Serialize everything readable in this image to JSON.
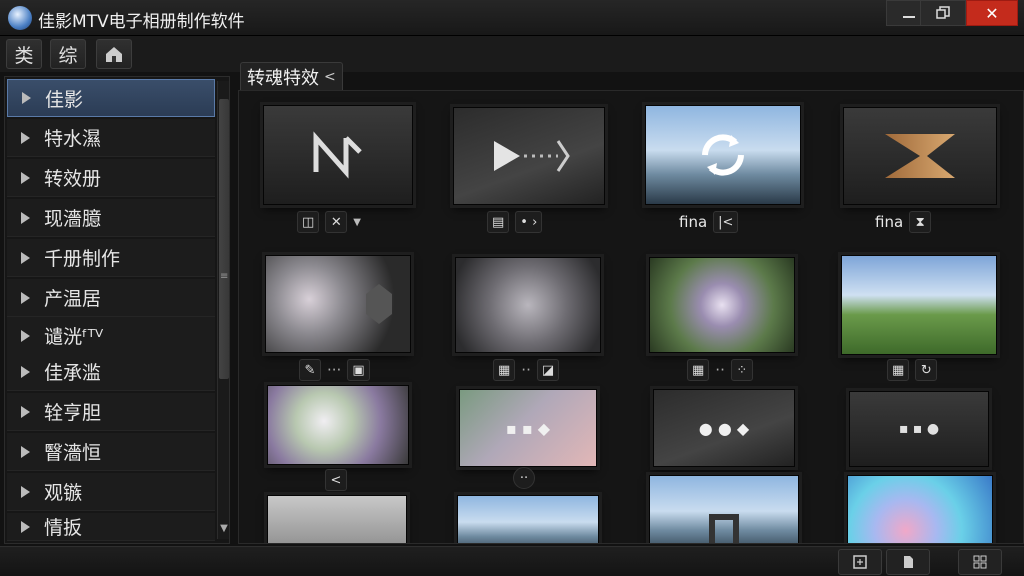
{
  "window": {
    "title": "佳影MTV电子相册制作软件",
    "minimize_icon": "minimize-icon",
    "maximize_icon": "restore-icon",
    "close_label": "✕"
  },
  "toolbar": {
    "button1_label": "类",
    "button2_label": "综",
    "button3_icon": "home-lock-icon"
  },
  "sidebar": {
    "items": [
      {
        "label": "佳影",
        "active": true
      },
      {
        "label": "特水濕"
      },
      {
        "label": "转效册"
      },
      {
        "label": "现濇臆"
      },
      {
        "label": "千册制作"
      },
      {
        "label": "产温居"
      },
      {
        "label": "谴洸ᶠᵀⱽ"
      },
      {
        "label": "佳承滥"
      },
      {
        "label": "辁亨胆"
      },
      {
        "label": "瞖濇恒"
      },
      {
        "label": "观镞"
      },
      {
        "label": "情扳"
      }
    ]
  },
  "tab": {
    "label": "转魂特效",
    "chevron": "<"
  },
  "thumbnails": [
    {
      "caption_text": "",
      "style": "dark1"
    },
    {
      "caption_text": "",
      "style": "dark2"
    },
    {
      "caption_text": "fina",
      "style": "sky"
    },
    {
      "caption_text": "fina",
      "style": "dark1"
    },
    {
      "caption_text": "",
      "style": "bokeh1"
    },
    {
      "caption_text": "",
      "style": "bokeh2"
    },
    {
      "caption_text": "",
      "style": "bokeh3"
    },
    {
      "caption_text": "",
      "style": "field"
    },
    {
      "caption_text": "",
      "style": "pastel1"
    },
    {
      "caption_text": "",
      "style": "pastel2"
    },
    {
      "caption_text": "",
      "style": "dark2"
    },
    {
      "caption_text": "",
      "style": "dark1"
    },
    {
      "caption_text": "",
      "style": "gray1"
    },
    {
      "caption_text": "",
      "style": "sky"
    },
    {
      "caption_text": "",
      "style": "sky"
    },
    {
      "caption_text": "",
      "style": "colorful"
    }
  ],
  "status_icons": [
    "info-icon",
    "page-icon",
    "grid-icon"
  ]
}
